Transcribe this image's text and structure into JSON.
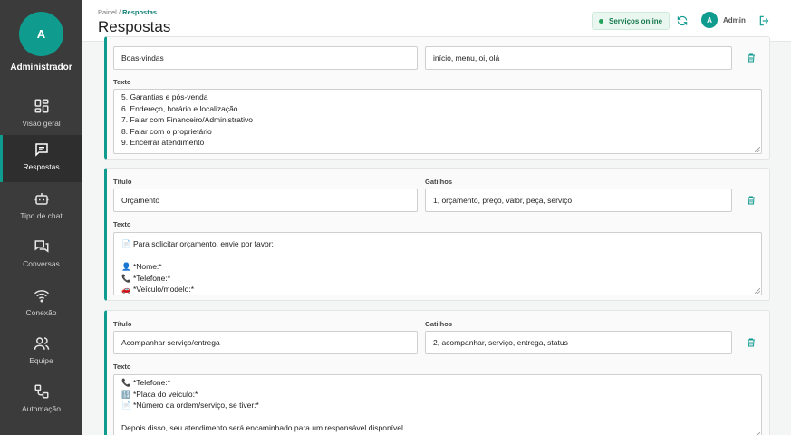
{
  "sidebar": {
    "avatar_letter": "A",
    "user_label": "Administrador",
    "items": [
      {
        "label": "Visão geral",
        "icon": "grid-icon"
      },
      {
        "label": "Respostas",
        "icon": "message-icon"
      },
      {
        "label": "Tipo de chat",
        "icon": "bot-icon"
      },
      {
        "label": "Conversas",
        "icon": "chat-bubbles-icon"
      },
      {
        "label": "Conexão",
        "icon": "wifi-icon"
      },
      {
        "label": "Equipe",
        "icon": "users-icon"
      },
      {
        "label": "Automação",
        "icon": "workflow-icon"
      }
    ],
    "active_index": 1
  },
  "header": {
    "breadcrumb_root": "Painel",
    "breadcrumb_sep": " / ",
    "breadcrumb_current": "Respostas",
    "title": "Respostas",
    "status": "Serviços online",
    "avatar_letter": "A",
    "user": "Admin"
  },
  "colors": {
    "accent": "#0f9b8e",
    "sidebar": "#3b3b3b",
    "status_green": "#22a35a"
  },
  "responses": [
    {
      "title_label": "",
      "triggers_label": "",
      "title": "Boas-vindas",
      "triggers": "início, menu, oi, olá",
      "text_label": "Texto",
      "text_lines": [
        "5. Garantias e pós-venda",
        "6. Endereço, horário e localização",
        "7. Falar com Financeiro/Administrativo",
        "8. Falar com o proprietário",
        "9. Encerrar atendimento"
      ]
    },
    {
      "title_label": "Título",
      "triggers_label": "Gatilhos",
      "title": "Orçamento",
      "triggers": "1, orçamento, preço, valor, peça, serviço",
      "text_label": "Texto",
      "text_lines": [
        "📄 Para solicitar orçamento, envie por favor:",
        "",
        "👤 *Nome:*",
        "📞 *Telefone:*",
        "🚗 *Veículo/modelo:*"
      ]
    },
    {
      "title_label": "Título",
      "triggers_label": "Gatilhos",
      "title": "Acompanhar serviço/entrega",
      "triggers": "2, acompanhar, serviço, entrega, status",
      "text_label": "Texto",
      "text_lines": [
        "📞 *Telefone:*",
        "🔢 *Placa do veículo:*",
        "📄 *Número da ordem/serviço, se tiver:*",
        "",
        "Depois disso, seu atendimento será encaminhado para um responsável disponível."
      ]
    }
  ]
}
